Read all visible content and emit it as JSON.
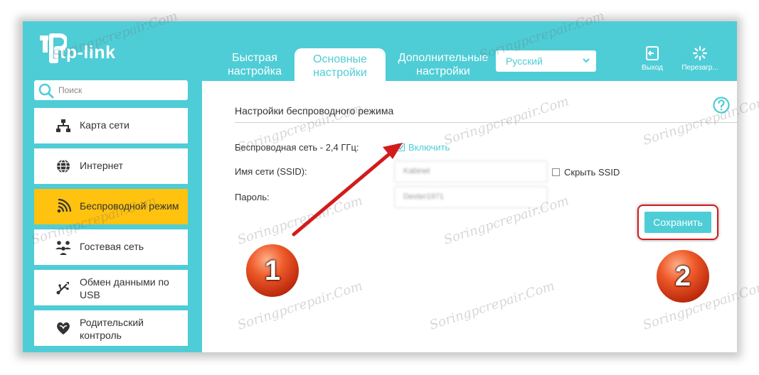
{
  "header": {
    "logo_text": "tp-link",
    "tabs": [
      {
        "label": "Быстрая настройка"
      },
      {
        "label": "Основные настройки"
      },
      {
        "label": "Дополнительные настройки"
      }
    ],
    "language": "Русский",
    "logout_label": "Выход",
    "reboot_label": "Перезагр..."
  },
  "sidebar": {
    "search_placeholder": "Поиск",
    "items": [
      {
        "label": "Карта сети",
        "icon": "network-map-icon"
      },
      {
        "label": "Интернет",
        "icon": "globe-icon"
      },
      {
        "label": "Беспроводной режим",
        "icon": "wireless-icon"
      },
      {
        "label": "Гостевая сеть",
        "icon": "guest-network-icon"
      },
      {
        "label": "Обмен данными по USB",
        "icon": "usb-icon"
      },
      {
        "label": "Родительский контроль",
        "icon": "parental-control-icon"
      }
    ]
  },
  "content": {
    "title": "Настройки беспроводного режима",
    "wireless_label": "Беспроводная сеть - 2,4 ГГц:",
    "enable_label": "Включить",
    "ssid_label": "Имя сети (SSID):",
    "ssid_value": "Kabinet",
    "hide_ssid_label": "Скрыть SSID",
    "password_label": "Пароль:",
    "password_value": "Dexter1971",
    "save_label": "Сохранить"
  },
  "annotations": {
    "badge1": "1",
    "badge2": "2",
    "watermark": "Soringpcrepair.Com"
  },
  "colors": {
    "accent": "#4ecdd6",
    "active_item": "#ffc20e",
    "annotation_red": "#d31b1b"
  }
}
